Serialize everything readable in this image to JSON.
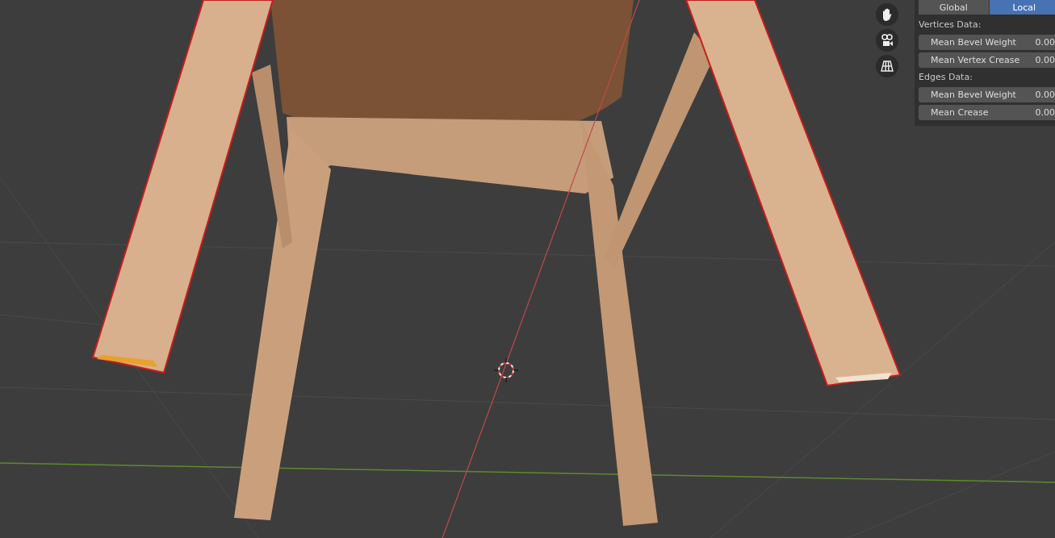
{
  "orientation_tabs": [
    {
      "label": "Global",
      "selected": false
    },
    {
      "label": "Local",
      "selected": true
    }
  ],
  "sections": [
    {
      "title": "Vertices Data:",
      "fields": [
        {
          "label": "Mean Bevel Weight",
          "value": "0.00"
        },
        {
          "label": "Mean Vertex Crease",
          "value": "0.00"
        }
      ]
    },
    {
      "title": "Edges Data:",
      "fields": [
        {
          "label": "Mean Bevel Weight",
          "value": "0.00"
        },
        {
          "label": "Mean Crease",
          "value": "0.00"
        }
      ]
    }
  ],
  "viewport_tools": [
    {
      "kind": "hand"
    },
    {
      "kind": "camera"
    },
    {
      "kind": "grid"
    }
  ]
}
